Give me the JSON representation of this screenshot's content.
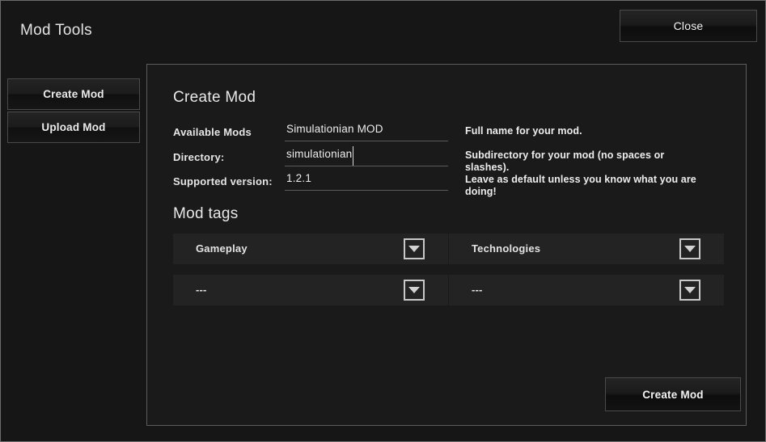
{
  "window": {
    "title": "Mod Tools",
    "close_label": "Close"
  },
  "sidebar": {
    "items": [
      {
        "label": "Create Mod"
      },
      {
        "label": "Upload Mod"
      }
    ]
  },
  "panel": {
    "heading": "Create Mod",
    "form": {
      "fields": [
        {
          "label": "Available Mods",
          "value": "Simulationian MOD",
          "help": "Full name for your mod."
        },
        {
          "label": "Directory:",
          "value": "simulationian",
          "help": "Subdirectory for your mod (no spaces or slashes).\nLeave as default unless you know what you are doing!"
        },
        {
          "label": "Supported version:",
          "value": "1.2.1",
          "help": ""
        }
      ]
    },
    "tags": {
      "heading": "Mod tags",
      "dropdowns": [
        {
          "value": "Gameplay"
        },
        {
          "value": "Technologies"
        },
        {
          "value": "---"
        },
        {
          "value": "---"
        }
      ]
    },
    "submit_label": "Create Mod"
  },
  "colors": {
    "window_bg": "#161616",
    "panel_bg": "#1a1a1a",
    "row_bg": "#232323",
    "border": "#5c5c5c",
    "text": "#e8e8e8"
  }
}
